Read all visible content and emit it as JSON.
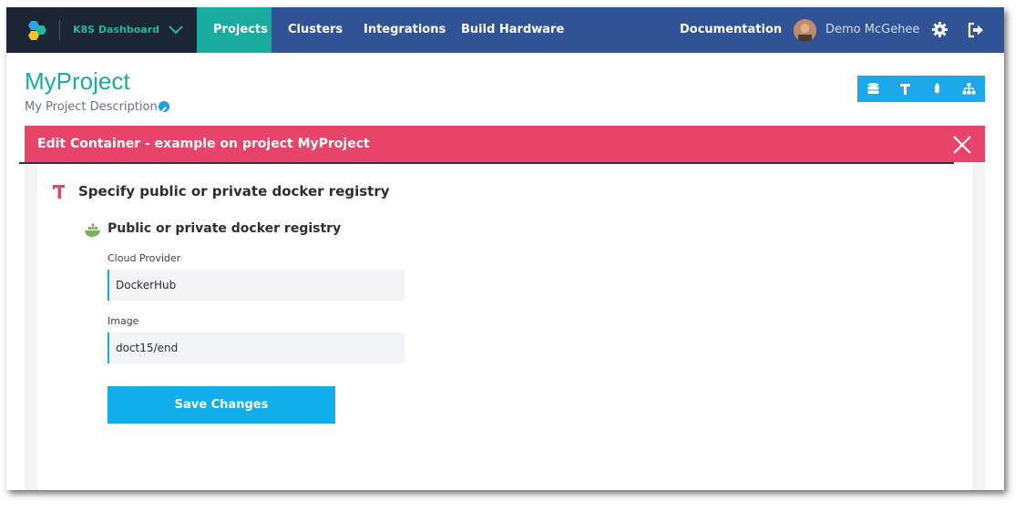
{
  "topbar": {
    "brand_title": "K8S Dashboard",
    "nav": [
      "Projects",
      "Clusters",
      "Integrations",
      "Build Hardware"
    ],
    "active_nav": "Projects",
    "documentation": "Documentation",
    "user_name": "Demo McGehee"
  },
  "project": {
    "title": "MyProject",
    "description": "My Project Description"
  },
  "toolbar": {
    "icons": [
      "database-icon",
      "hammer-icon",
      "rocket-icon",
      "sitemap-icon"
    ]
  },
  "panel": {
    "title": "Edit Container - example on project MyProject",
    "step_title": "Specify public or private docker registry",
    "section_title": "Public or private docker registry",
    "cloud_provider_label": "Cloud Provider",
    "cloud_provider_value": "DockerHub",
    "image_label": "Image",
    "image_value": "doct15/end",
    "save_label": "Save Changes"
  },
  "colors": {
    "topbar": "#2f5395",
    "brand_bg": "#1c2533",
    "accent_teal": "#1aab9f",
    "header_pink": "#e84369",
    "button_blue": "#10aeea"
  }
}
